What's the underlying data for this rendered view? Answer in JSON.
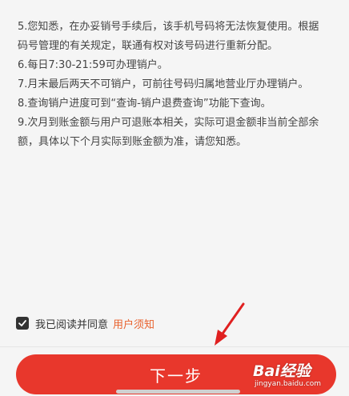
{
  "notice": {
    "lines": [
      "5.您知悉，在办妥销号手续后，该手机号码将无法恢复使用。根据",
      "码号管理的有关规定，联通有权对该号码进行重新分配。",
      "6.每日7:30-21:59可办理销户。",
      "7.月末最后两天不可销户，可前往号码归属地营业厅办理销户。",
      "8.查询销户进度可到“查询-销户退费查询”功能下查询。",
      "9.次月到账金额与用户可退账本相关，实际可退金额非当前全部余",
      "额，具体以下个月实际到账金额为准，请您知悉。"
    ]
  },
  "agreement": {
    "checked": true,
    "text": "我已阅读并同意",
    "link_label": "用户须知"
  },
  "footer": {
    "next_label": "下一步"
  },
  "watermark": {
    "logo": "Bai经验",
    "url": "jingyan.baidu.com"
  },
  "colors": {
    "accent": "#e8372c",
    "link": "#e8602c",
    "annotation_arrow": "#e02020"
  },
  "icons": {
    "checkbox": "checkmark-icon",
    "annotation": "arrow-icon"
  }
}
